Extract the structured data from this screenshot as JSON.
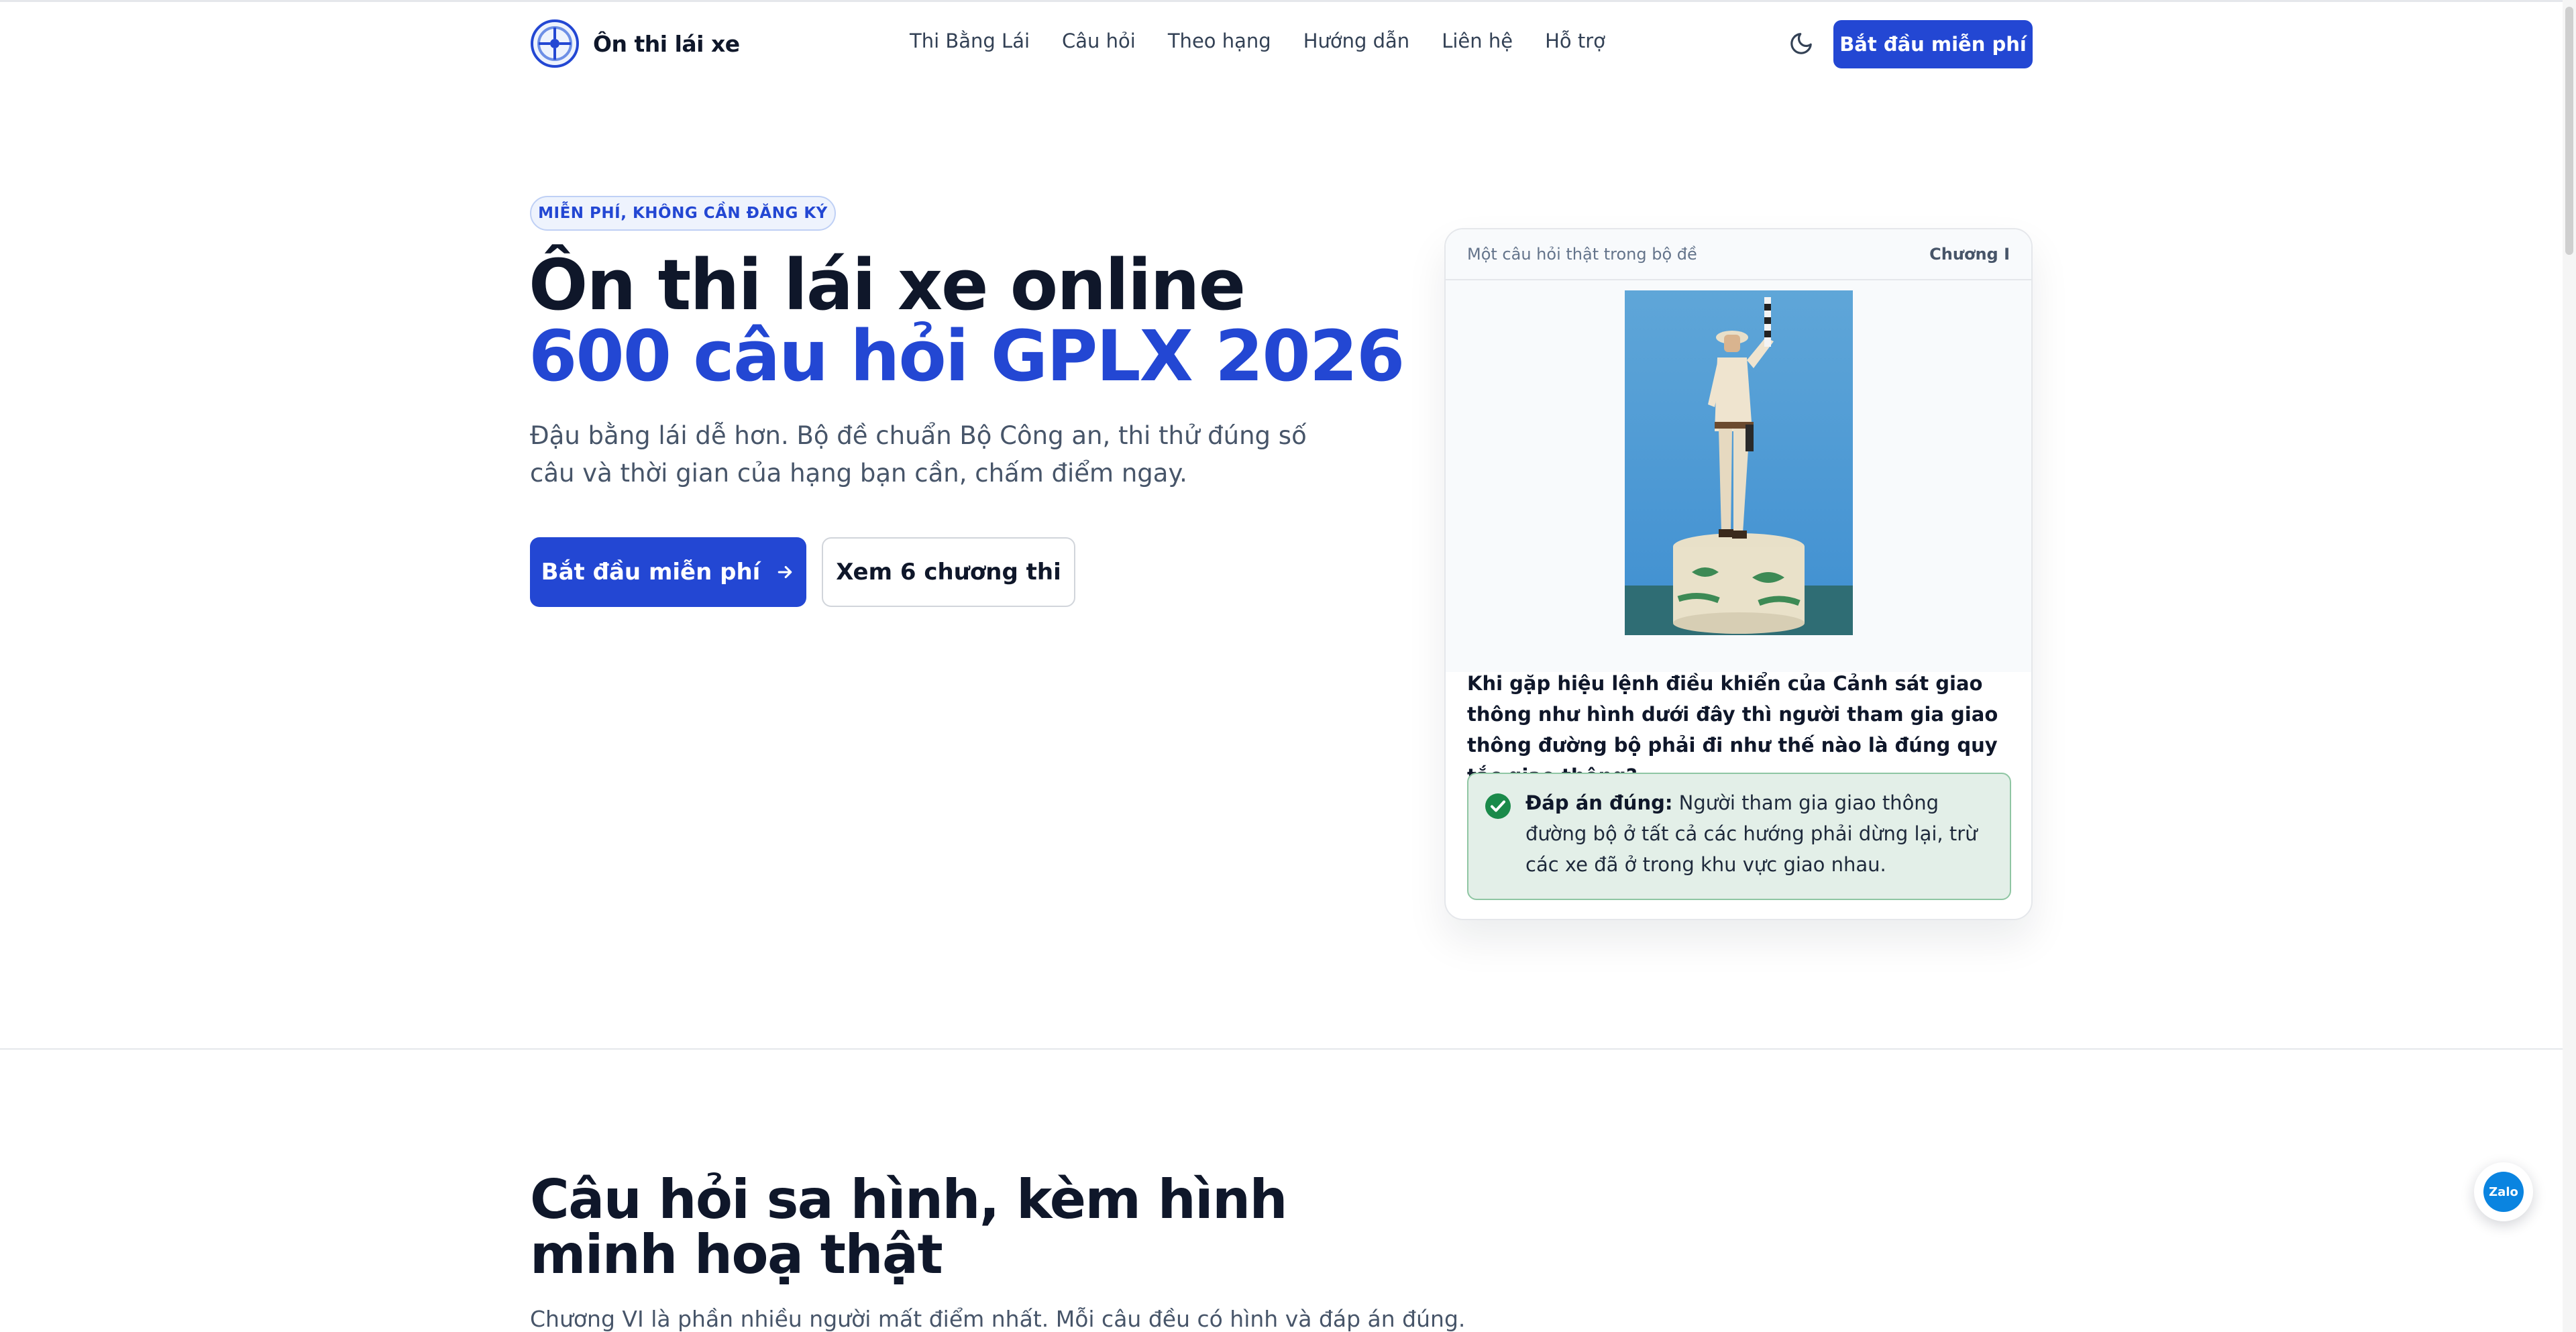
{
  "brand": {
    "name": "Ôn thi lái xe"
  },
  "nav": {
    "items": [
      {
        "label": "Thi Bằng Lái"
      },
      {
        "label": "Câu hỏi"
      },
      {
        "label": "Theo hạng"
      },
      {
        "label": "Hướng dẫn"
      },
      {
        "label": "Liên hệ"
      },
      {
        "label": "Hỗ trợ"
      }
    ],
    "cta_label": "Bắt đầu miễn phí"
  },
  "hero": {
    "badge": "MIỄN PHÍ, KHÔNG CẦN ĐĂNG KÝ",
    "title_line1": "Ôn thi lái xe online",
    "title_line2": "600 câu hỏi GPLX 2026",
    "subtitle": "Đậu bằng lái dễ hơn. Bộ đề chuẩn Bộ Công an, thi thử đúng số câu và thời gian của hạng bạn cần, chấm điểm ngay.",
    "primary_button": "Bắt đầu miễn phí",
    "secondary_button": "Xem 6 chương thi"
  },
  "card": {
    "note": "Một câu hỏi thật trong bộ đề",
    "chapter": "Chương I",
    "question": "Khi gặp hiệu lệnh điều khiển của Cảnh sát giao thông như hình dưới đây thì người tham gia giao thông đường bộ phải đi như thế nào là đúng quy tắc giao thông?",
    "answer_label": "Đáp án đúng:",
    "answer_text": "Người tham gia giao thông đường bộ ở tất cả các hướng phải dừng lại, trừ các xe đã ở trong khu vực giao nhau."
  },
  "section": {
    "title": "Câu hỏi sa hình, kèm hình minh hoạ thật",
    "subtitle": "Chương VI là phần nhiều người mất điểm nhất. Mỗi câu đều có hình và đáp án đúng."
  },
  "zalo": {
    "label": "Zalo"
  },
  "colors": {
    "accent": "#2347d3",
    "success": "#1a8a4a",
    "success_bg": "#e3efe8"
  },
  "icons": {
    "logo": "steering-wheel-icon",
    "theme": "moon-icon",
    "arrow": "arrow-right-icon",
    "check": "check-circle-icon"
  }
}
